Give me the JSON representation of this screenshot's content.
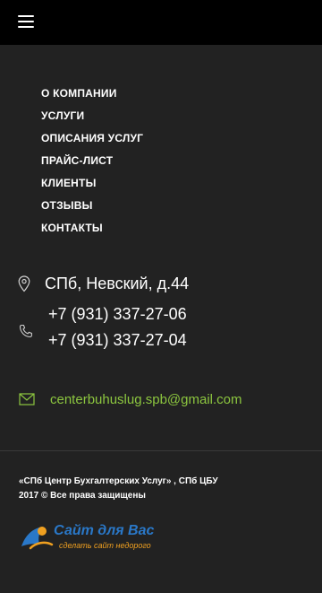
{
  "menu": {
    "items": [
      {
        "label": "О КОМПАНИИ"
      },
      {
        "label": "УСЛУГИ"
      },
      {
        "label": "ОПИСАНИЯ УСЛУГ"
      },
      {
        "label": "ПРАЙС-ЛИСТ"
      },
      {
        "label": "КЛИЕНТЫ"
      },
      {
        "label": "ОТЗЫВЫ"
      },
      {
        "label": "КОНТАКТЫ"
      }
    ]
  },
  "contacts": {
    "address": "СПб, Невский, д.44",
    "phone_1": "+7 (931) 337-27-06",
    "phone_2": "+7 (931) 337-27-04",
    "email": "centerbuhuslug.spb@gmail.com"
  },
  "footer": {
    "copyright_line1": "«СПб Центр Бухгалтерских Услуг» , СПб ЦБУ",
    "copyright_line2": "2017 © Все права защищены",
    "logo_title": "Сайт для Вас",
    "logo_subtitle": "сделать сайт недорого"
  },
  "icons": {
    "menu": "hamburger-icon",
    "address": "map-pin-icon",
    "phone": "phone-icon",
    "email": "envelope-icon"
  },
  "colors": {
    "background": "#222222",
    "topbar": "#000000",
    "email_accent": "#8cc63f",
    "logo_blue": "#2a78c8",
    "logo_orange": "#f0a020"
  }
}
